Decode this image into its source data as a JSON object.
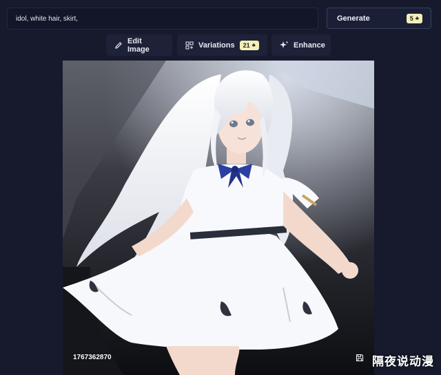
{
  "prompt": {
    "value": "idol, white hair, skirt,"
  },
  "generate": {
    "label": "Generate",
    "cost": "5"
  },
  "toolbar": {
    "edit_label": "Edit Image",
    "variations_label": "Variations",
    "variations_cost": "21",
    "enhance_label": "Enhance"
  },
  "image": {
    "seed": "1767362870"
  },
  "watermark": {
    "text": "隔夜说动漫"
  },
  "colors": {
    "background": "#161a2c",
    "badge": "#f3efb8",
    "button": "#1e2238"
  }
}
